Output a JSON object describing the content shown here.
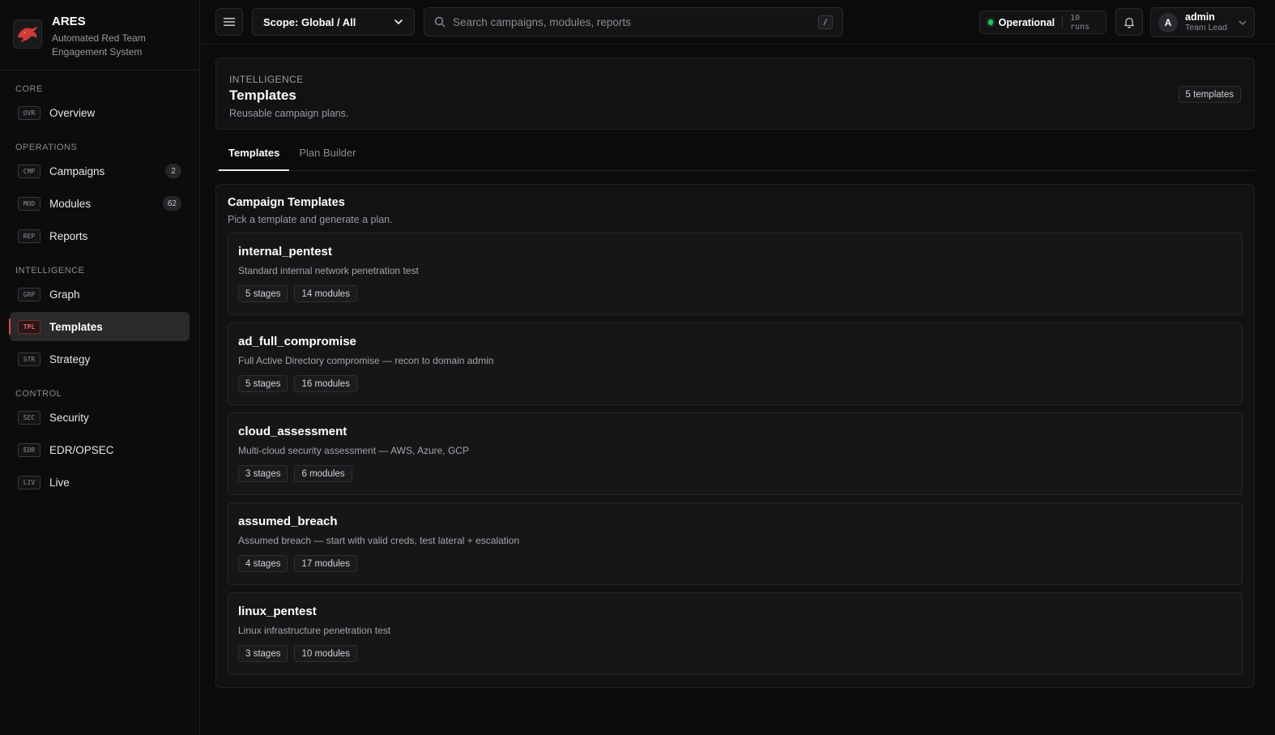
{
  "brand": {
    "name": "ARES",
    "subtitle": "Automated Red Team Engagement System",
    "logo_icon": "dragon-icon",
    "accent": "#e04848"
  },
  "sidebar": {
    "sections": [
      {
        "label": "CORE",
        "items": [
          {
            "code": "OVR",
            "label": "Overview",
            "badge": null,
            "active": false
          }
        ]
      },
      {
        "label": "OPERATIONS",
        "items": [
          {
            "code": "CMP",
            "label": "Campaigns",
            "badge": "2",
            "active": false
          },
          {
            "code": "MOD",
            "label": "Modules",
            "badge": "62",
            "active": false
          },
          {
            "code": "REP",
            "label": "Reports",
            "badge": null,
            "active": false
          }
        ]
      },
      {
        "label": "INTELLIGENCE",
        "items": [
          {
            "code": "GRP",
            "label": "Graph",
            "badge": null,
            "active": false
          },
          {
            "code": "TPL",
            "label": "Templates",
            "badge": null,
            "active": true
          },
          {
            "code": "STR",
            "label": "Strategy",
            "badge": null,
            "active": false
          }
        ]
      },
      {
        "label": "CONTROL",
        "items": [
          {
            "code": "SEC",
            "label": "Security",
            "badge": null,
            "active": false
          },
          {
            "code": "EDR",
            "label": "EDR/OPSEC",
            "badge": null,
            "active": false
          },
          {
            "code": "LIV",
            "label": "Live",
            "badge": null,
            "active": false
          }
        ]
      }
    ]
  },
  "topbar": {
    "scope_label": "Scope: Global / All",
    "search_placeholder": "Search campaigns, modules, reports",
    "search_shortcut": "/",
    "status_label": "Operational",
    "status_color": "#22c55e",
    "runs_label": "10 runs",
    "user": {
      "initial": "A",
      "name": "admin",
      "role": "Team Lead"
    }
  },
  "header": {
    "eyebrow": "INTELLIGENCE",
    "title": "Templates",
    "subtitle": "Reusable campaign plans.",
    "count": "5 templates"
  },
  "tabs": [
    {
      "label": "Templates",
      "active": true
    },
    {
      "label": "Plan Builder",
      "active": false
    }
  ],
  "templates_card": {
    "title": "Campaign Templates",
    "subtitle": "Pick a template and generate a plan.",
    "items": [
      {
        "name": "internal_pentest",
        "description": "Standard internal network penetration test",
        "stages": "5 stages",
        "modules": "14 modules"
      },
      {
        "name": "ad_full_compromise",
        "description": "Full Active Directory compromise — recon to domain admin",
        "stages": "5 stages",
        "modules": "16 modules"
      },
      {
        "name": "cloud_assessment",
        "description": "Multi-cloud security assessment — AWS, Azure, GCP",
        "stages": "3 stages",
        "modules": "6 modules"
      },
      {
        "name": "assumed_breach",
        "description": "Assumed breach — start with valid creds, test lateral + escalation",
        "stages": "4 stages",
        "modules": "17 modules"
      },
      {
        "name": "linux_pentest",
        "description": "Linux infrastructure penetration test",
        "stages": "3 stages",
        "modules": "10 modules"
      }
    ]
  }
}
